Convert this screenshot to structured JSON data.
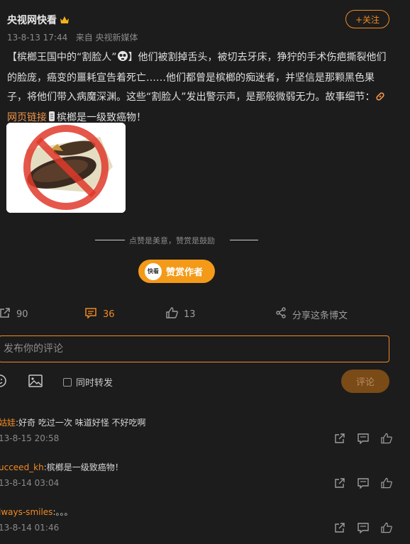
{
  "post": {
    "author": "央视网快看",
    "time": "13-8-13 17:44",
    "source": "来自 央视新媒体",
    "follow_label": "+关注",
    "text_part1": "【槟榔王国中的“割脸人”",
    "text_part2": "】他们被割掉舌头，被切去牙床，狰狞的手术伤疤撕裂他们的脸庞，癌变的噩耗宣告着死亡……他们都曾是槟榔的痴迷者，并坚信是那颗黑色果子，将他们带入病魔深渊。这些“割脸人”发出警示声，是那般微弱无力。故事细节：",
    "link_text": "网页链接",
    "text_part3": "槟榔是一级致癌物！"
  },
  "reward": {
    "tip": "点赞是美意，赞赏是鼓励",
    "badge": "快看",
    "label": "赞赏作者"
  },
  "actions": {
    "repost_count": "90",
    "comment_count": "36",
    "like_count": "13",
    "share_label": "分享这条博文"
  },
  "composer": {
    "placeholder": "发布你的评论",
    "forward_label": "同时转发",
    "submit_label": "评论"
  },
  "comments": [
    {
      "user": "姑娃",
      "text": ":好奇 吃过一次 味道好怪 不好吃啊",
      "time": "13-8-15 20:58"
    },
    {
      "user": "ucceed_kh",
      "text": ":槟榔是一级致癌物！",
      "time": "13-8-14 03:04"
    },
    {
      "user": "lways-smiles",
      "text": ":。。。",
      "time": "13-8-14 01:46"
    }
  ],
  "colors": {
    "accent": "#f08a24",
    "background": "#1c1c1c",
    "reward": "#f39a19"
  }
}
